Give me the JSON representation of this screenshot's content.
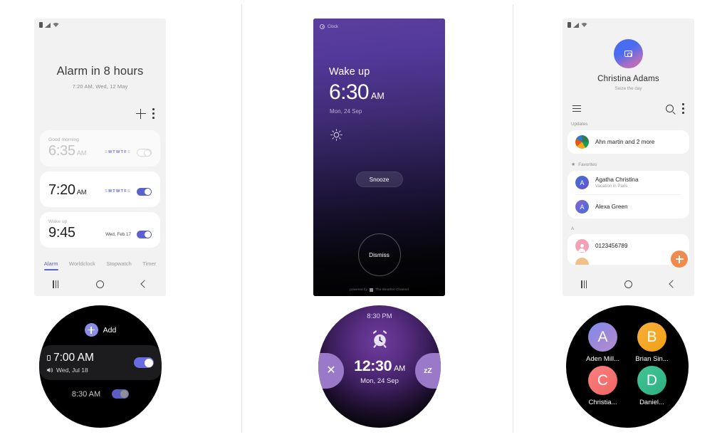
{
  "phone_alarm_list": {
    "status_bar": {
      "icons": [
        "battery-icon",
        "signal-icon",
        "wifi-icon"
      ]
    },
    "headline": "Alarm in 8 hours",
    "subline": "7:20 AM, Wed, 12 May",
    "add_icon": "plus-icon",
    "more_icon": "kebab-menu-icon",
    "alarms": [
      {
        "label": "Good morning",
        "time": "6:35",
        "ampm": "AM",
        "days": "SMTWTFS",
        "active_days": "MTWTF",
        "enabled": false
      },
      {
        "label": "",
        "time": "7:20",
        "ampm": "AM",
        "days": "SMTWTFS",
        "active_days": "MTWTF",
        "enabled": true
      },
      {
        "label": "Wake up",
        "time": "9:45",
        "ampm": "AM",
        "date": "Wed, Feb 17",
        "enabled": true
      }
    ],
    "tabs": [
      {
        "label": "Alarm",
        "selected": true
      },
      {
        "label": "Worldclock",
        "selected": false
      },
      {
        "label": "Stopwatch",
        "selected": false
      },
      {
        "label": "Timer",
        "selected": false
      }
    ],
    "nav": {
      "recents": "recents-icon",
      "home": "home-icon",
      "back": "back-icon"
    }
  },
  "phone_alarm_ringing": {
    "app_chip": "Clock",
    "app_chip_icon": "clock-icon",
    "label": "Wake up",
    "time": "6:30",
    "ampm": "AM",
    "date": "Mon, 24 Sep",
    "weather_icon": "sun-icon",
    "snooze_label": "Snooze",
    "dismiss_label": "Dismiss",
    "powered_by": "powered by",
    "weather_provider": "The Weather Channel",
    "accent": "#5b3f9e"
  },
  "phone_contacts": {
    "status_bar": {
      "icons": [
        "battery-icon",
        "signal-icon",
        "wifi-icon"
      ]
    },
    "profile": {
      "name": "Christina  Adams",
      "status": "Seize the day",
      "avatar_icon": "camera-icon"
    },
    "menu_icon": "hamburger-menu-icon",
    "search_icon": "search-icon",
    "more_icon": "kebab-menu-icon",
    "sections": [
      {
        "title": "Updates",
        "star": false,
        "rows": [
          {
            "name": "Ahn martin and 2 more",
            "sub": "",
            "avatar_type": "pie",
            "initial": "",
            "color": ""
          }
        ]
      },
      {
        "title": "Favorites",
        "star": true,
        "rows": [
          {
            "name": "Agatha Christina",
            "sub": "Vacation in Paris",
            "avatar_type": "initial",
            "initial": "A",
            "color": "#3f6fd8"
          },
          {
            "name": "Alexa Green",
            "sub": "",
            "avatar_type": "initial",
            "initial": "A",
            "color": "#3f6fd8"
          }
        ]
      },
      {
        "title": "A",
        "star": false,
        "rows": [
          {
            "name": "0123456789",
            "sub": "",
            "avatar_type": "person",
            "initial": "",
            "color": "#f4a0b5"
          }
        ]
      }
    ],
    "fab_icon": "plus-icon",
    "fab_color": "#ef8b4e",
    "nav": {
      "recents": "recents-icon",
      "home": "home-icon",
      "back": "back-icon"
    }
  },
  "watch_alarm_list": {
    "add_label": "Add",
    "add_icon": "plus-icon",
    "alarm": {
      "time": "7:00 AM",
      "date": "Wed, Jul 18",
      "phone_icon": "phone-icon",
      "sound_icon": "speaker-icon",
      "enabled": true
    },
    "next_alarm": {
      "time": "8:30 AM",
      "enabled": true
    },
    "accent": "#6a6be0"
  },
  "watch_alarm_ringing": {
    "current_time": "8:30 PM",
    "alarm_icon": "alarm-clock-icon",
    "time": "12:30",
    "ampm": "AM",
    "date": "Mon, 24 Sep",
    "dismiss_icon": "close-icon",
    "snooze_label": "zZ",
    "accent": "#9b79c9"
  },
  "watch_contacts": {
    "contacts": [
      {
        "initial": "A",
        "name": "Aden Mill...",
        "color": "#9b87d8"
      },
      {
        "initial": "B",
        "name": "Brian Sin...",
        "color": "#f5a623"
      },
      {
        "initial": "C",
        "name": "Christia...",
        "color": "#f4706e"
      },
      {
        "initial": "D",
        "name": "Daniel...",
        "color": "#35b98a"
      }
    ]
  }
}
